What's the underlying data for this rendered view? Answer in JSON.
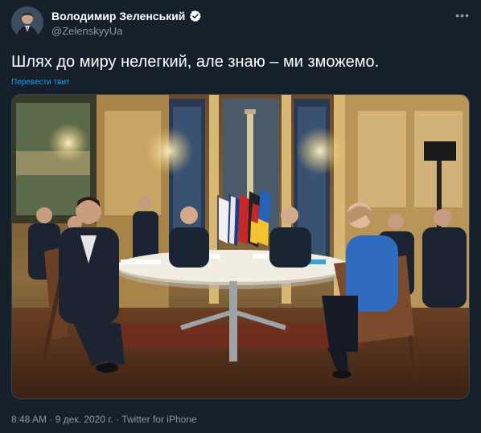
{
  "author": {
    "display_name": "Володимир Зеленський",
    "handle": "@ZelenskyyUa",
    "verified": true,
    "avatar_icon": "profile-photo"
  },
  "tweet": {
    "text": "Шлях до миру нелегкий, але знаю – ми зможемо.",
    "translate_label": "Перевести твит",
    "more_icon": "more-dots-icon"
  },
  "media": {
    "type": "photo",
    "icon": "meeting-photo"
  },
  "meta": {
    "time": "8:48 AM",
    "separator1": "·",
    "date": "9 дек. 2020 г.",
    "separator2": "·",
    "source": "Twitter for iPhone"
  },
  "colors": {
    "background": "#15202b",
    "accent": "#1da1f2",
    "secondary_text": "#8899a6"
  }
}
